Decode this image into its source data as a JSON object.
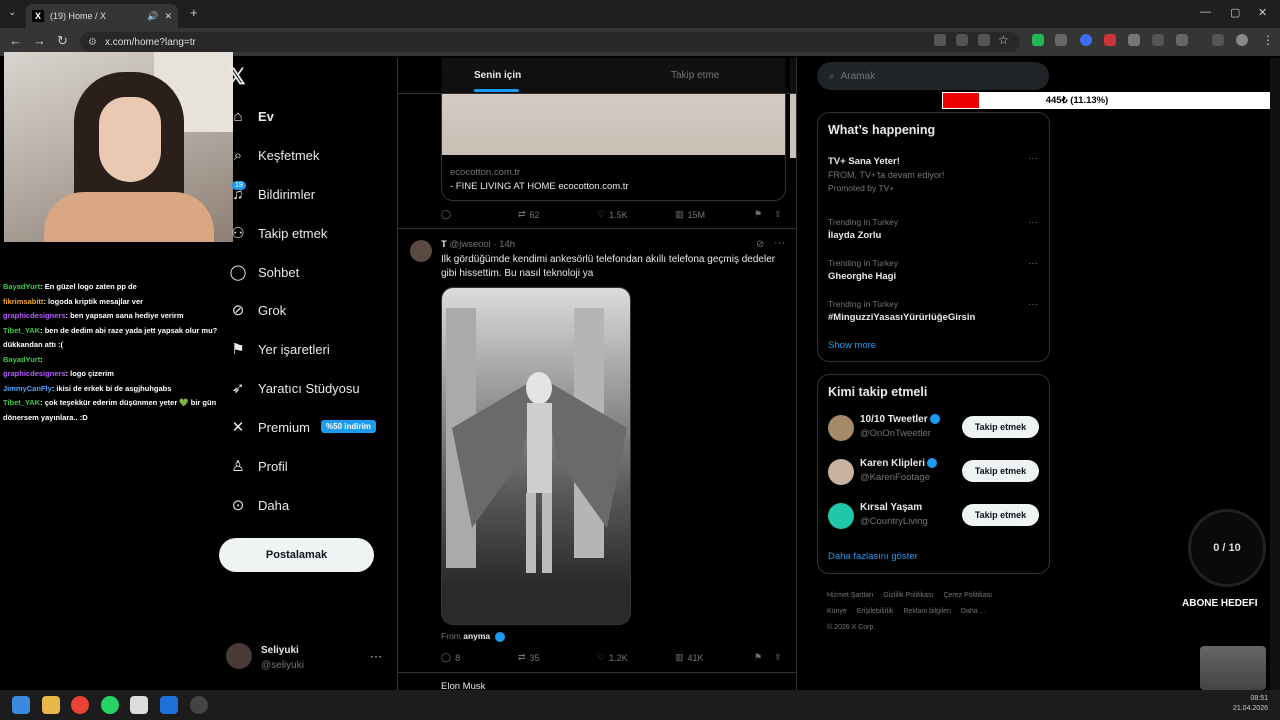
{
  "browser": {
    "tab_title": "(19) Home / X",
    "favicon": "X",
    "url": "x.com/home?lang=tr"
  },
  "chat": [
    {
      "user": "BayadYurt",
      "color": "#39c94a",
      "msg": ": En güzel logo zaten pp de"
    },
    {
      "user": "fikrimsabitt",
      "color": "#f5a623",
      "msg": ": logoda kriptik mesajlar ver"
    },
    {
      "user": "graphicdesigners",
      "color": "#b75cff",
      "msg": ": ben yapsam sana hediye verirm"
    },
    {
      "user": "Tibet_YAK",
      "color": "#39c94a",
      "msg": ": ben de dedim abi raze yada jett yapsak olur mu? dükkandan attı :("
    },
    {
      "user": "BayadYurt",
      "color": "#39c94a",
      "msg": ":"
    },
    {
      "user": "graphicdesigners",
      "color": "#b75cff",
      "msg": ": logo çizerim"
    },
    {
      "user": "JimmyCanFly",
      "color": "#4aa3ff",
      "msg": ": ikisi de erkek bi de asgjhuhgabs"
    },
    {
      "user": "Tibet_YAK",
      "color": "#39c94a",
      "msg": ": çok teşekkür ederim düşünmen yeter 💚 bir gün dönersem yayınlara.. :D"
    }
  ],
  "sidebar": {
    "items": [
      {
        "label": "Ev",
        "icon": "home-icon",
        "glyph": "⌂"
      },
      {
        "label": "Keşfetmek",
        "icon": "search-icon",
        "glyph": "⌕"
      },
      {
        "label": "Bildirimler",
        "icon": "bell-icon",
        "glyph": "♫"
      },
      {
        "label": "Takip etmek",
        "icon": "follow-icon",
        "glyph": "⚇"
      },
      {
        "label": "Sohbet",
        "icon": "chat-icon",
        "glyph": "◯"
      },
      {
        "label": "Grok",
        "icon": "grok-icon",
        "glyph": "⊘"
      },
      {
        "label": "Yer işaretleri",
        "icon": "bookmark-icon",
        "glyph": "⚑"
      },
      {
        "label": "Yaratıcı Stüdyosu",
        "icon": "rocket-icon",
        "glyph": "➶"
      },
      {
        "label": "Premium",
        "icon": "x-premium-icon",
        "glyph": "✕"
      },
      {
        "label": "Profil",
        "icon": "profile-icon",
        "glyph": "♙"
      },
      {
        "label": "Daha",
        "icon": "more-icon",
        "glyph": "⊙"
      }
    ],
    "notif_badge": "19",
    "premium_tag": "%50 indirim",
    "post_button": "Postalamak",
    "account": {
      "name": "Seliyuki",
      "handle": "@seliyuki"
    }
  },
  "timeline": {
    "tabs": [
      "Senin için",
      "Takip etme"
    ],
    "ad_card": {
      "domain": "ecocotton.com.tr",
      "title": "- FINE LIVING AT HOME ecocotton.com.tr",
      "actions": {
        "replies": "",
        "reposts": "62",
        "likes": "1.5K",
        "views": "15M"
      }
    },
    "tweet": {
      "author": "T",
      "handle": "@jwseool",
      "time": "· 14h",
      "text": "Ilk gördüğümde kendimi ankesörlü telefondan akıllı telefona geçmiş dedeler gibi hissettim. Bu nasıl teknoloji ya",
      "from_label": "From",
      "from_name": "anyma",
      "actions": {
        "replies": "8",
        "reposts": "35",
        "likes": "1.2K",
        "views": "41K"
      }
    },
    "next_author": "Elon Musk"
  },
  "right": {
    "search_placeholder": "Aramak",
    "goal_label": "445₺ (11.13%)",
    "goal_fraction": 0.1113,
    "happening_title": "What’s happening",
    "trends": [
      {
        "context": "",
        "topic": "TV+ Sana Yeter!",
        "sub": "FROM, TV+'ta devam ediyor!",
        "promo": "Promoted by TV+"
      },
      {
        "context": "Trending in Turkey",
        "topic": "İlayda Zorlu"
      },
      {
        "context": "Trending in Turkey",
        "topic": "Gheorghe Hagi"
      },
      {
        "context": "Trending in Turkey",
        "topic": "#MinguzziYasasıYürürlüğeGirsin"
      }
    ],
    "show_more": "Show more",
    "who_title": "Kimi takip etmeli",
    "who": [
      {
        "name": "10/10 Tweetler",
        "handle": "@OnOnTweetler",
        "button": "Takip etmek",
        "avatar": "#a58a6a"
      },
      {
        "name": "Karen Klipleri",
        "handle": "@KarenFootage",
        "button": "Takip etmek",
        "avatar": "#c9b3a0"
      },
      {
        "name": "Kırsal Yaşam",
        "handle": "@CountryLiving",
        "button": "Takip etmek",
        "avatar": "#1fc7a8"
      }
    ],
    "who_more": "Daha fazlasını göster",
    "footer_links": [
      "Hizmet Şartları",
      "Gizlilik Politikası",
      "Çerez Politikası",
      "Künye",
      "Erişilebilirlik",
      "Reklam bilgileri",
      "Daha ...",
      "© 2026 X Corp."
    ]
  },
  "overlay": {
    "counter": "0 / 10",
    "abone": "ABONE HEDEFI"
  },
  "taskbar": {
    "time": "08:51",
    "date": "21.04.2026"
  }
}
